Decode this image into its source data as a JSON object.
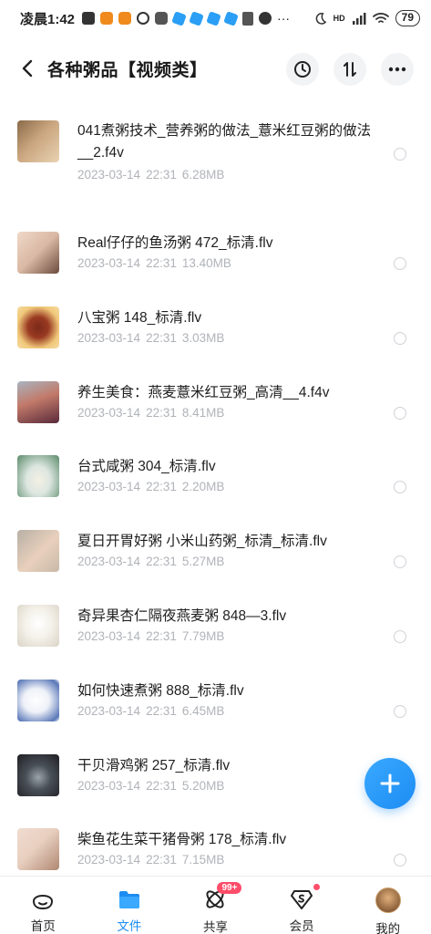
{
  "status_bar": {
    "time": "凌晨1:42",
    "network": "HD",
    "battery": "79"
  },
  "header": {
    "title": "各种粥品【视频类】",
    "icons": [
      "back-icon",
      "history-icon",
      "sort-icon",
      "more-icon"
    ]
  },
  "files": [
    {
      "name": "041煮粥技术_营养粥的做法_薏米红豆粥的做法__2.f4v",
      "date": "2023-03-14",
      "time": "22:31",
      "size": "6.28MB",
      "thumb": [
        "#8a6a4a",
        "#e9d3b3"
      ]
    },
    {
      "name": "Real仔仔的鱼汤粥 472_标清.flv",
      "date": "2023-03-14",
      "time": "22:31",
      "size": "13.40MB",
      "thumb": [
        "#d9b8a4",
        "#6b4a3c"
      ]
    },
    {
      "name": "八宝粥 148_标清.flv",
      "date": "2023-03-14",
      "time": "22:31",
      "size": "3.03MB",
      "thumb": [
        "#f0c87a",
        "#7a2a1a"
      ]
    },
    {
      "name": "养生美食：燕麦薏米红豆粥_高清__4.f4v",
      "date": "2023-03-14",
      "time": "22:31",
      "size": "8.41MB",
      "thumb": [
        "#c27a6a",
        "#5a2a3a"
      ]
    },
    {
      "name": "台式咸粥 304_标清.flv",
      "date": "2023-03-14",
      "time": "22:31",
      "size": "2.20MB",
      "thumb": [
        "#dce6e0",
        "#5a8a6a"
      ]
    },
    {
      "name": "夏日开胃好粥 小米山药粥_标清_标清.flv",
      "date": "2023-03-14",
      "time": "22:31",
      "size": "5.27MB",
      "thumb": [
        "#b8b0a6",
        "#e8d0bc"
      ]
    },
    {
      "name": "奇异果杏仁隔夜燕麦粥 848—3.flv",
      "date": "2023-03-14",
      "time": "22:31",
      "size": "7.79MB",
      "thumb": [
        "#f4f1ea",
        "#dad4c6"
      ]
    },
    {
      "name": "如何快速煮粥 888_标清.flv",
      "date": "2023-03-14",
      "time": "22:31",
      "size": "6.45MB",
      "thumb": [
        "#eef1f8",
        "#5a78b8"
      ]
    },
    {
      "name": "干贝滑鸡粥 257_标清.flv",
      "date": "2023-03-14",
      "time": "22:31",
      "size": "5.20MB",
      "thumb": [
        "#1e1e22",
        "#9aa4ac"
      ]
    },
    {
      "name": "柴鱼花生菜干猪骨粥 178_标清.flv",
      "date": "2023-03-14",
      "time": "22:31",
      "size": "7.15MB",
      "thumb": [
        "#e8cfc0",
        "#b08872"
      ]
    }
  ],
  "bottom_nav": [
    {
      "label": "首页",
      "icon": "home-icon",
      "active": false
    },
    {
      "label": "文件",
      "icon": "folder-icon",
      "active": true
    },
    {
      "label": "共享",
      "icon": "share-icon",
      "active": false,
      "badge": "99+"
    },
    {
      "label": "会员",
      "icon": "vip-icon",
      "active": false,
      "dot": true
    },
    {
      "label": "我的",
      "icon": "avatar",
      "active": false
    }
  ],
  "colors": {
    "accent": "#1c8cf3",
    "badge": "#ff4d6a",
    "meta_text": "#b0b3b8"
  }
}
